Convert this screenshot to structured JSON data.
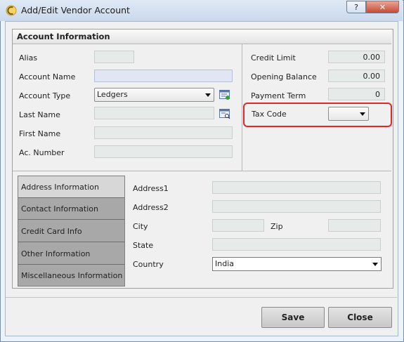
{
  "window": {
    "title": "Add/Edit Vendor Account",
    "help_label": "?",
    "close_label": "✕"
  },
  "section_title": "Account Information",
  "left_fields": {
    "alias": {
      "label": "Alias",
      "value": ""
    },
    "account_name": {
      "label": "Account Name",
      "value": ""
    },
    "account_type": {
      "label": "Account Type",
      "value": "Ledgers"
    },
    "last_name": {
      "label": "Last Name",
      "value": ""
    },
    "first_name": {
      "label": "First Name",
      "value": ""
    },
    "ac_number": {
      "label": "Ac. Number",
      "value": ""
    }
  },
  "right_fields": {
    "credit_limit": {
      "label": "Credit Limit",
      "value": "0.00"
    },
    "opening_balance": {
      "label": "Opening Balance",
      "value": "0.00"
    },
    "payment_term": {
      "label": "Payment Term",
      "value": "0"
    },
    "tax_code": {
      "label": "Tax Code",
      "value": ""
    }
  },
  "tabs": [
    {
      "label": "Address Information",
      "active": true
    },
    {
      "label": "Contact Information",
      "active": false
    },
    {
      "label": "Credit Card Info",
      "active": false
    },
    {
      "label": "Other Information",
      "active": false
    },
    {
      "label": "Miscellaneous Information",
      "active": false
    }
  ],
  "address": {
    "address1": {
      "label": "Address1",
      "value": ""
    },
    "address2": {
      "label": "Address2",
      "value": ""
    },
    "city": {
      "label": "City",
      "value": ""
    },
    "zip": {
      "label": "Zip",
      "value": ""
    },
    "state": {
      "label": "State",
      "value": ""
    },
    "country": {
      "label": "Country",
      "value": "India"
    }
  },
  "buttons": {
    "save": "Save",
    "close": "Close"
  },
  "colors": {
    "highlight": "#e02828"
  },
  "icons": {
    "app": "app-logo-icon",
    "lookup": "lookup-list-icon"
  }
}
